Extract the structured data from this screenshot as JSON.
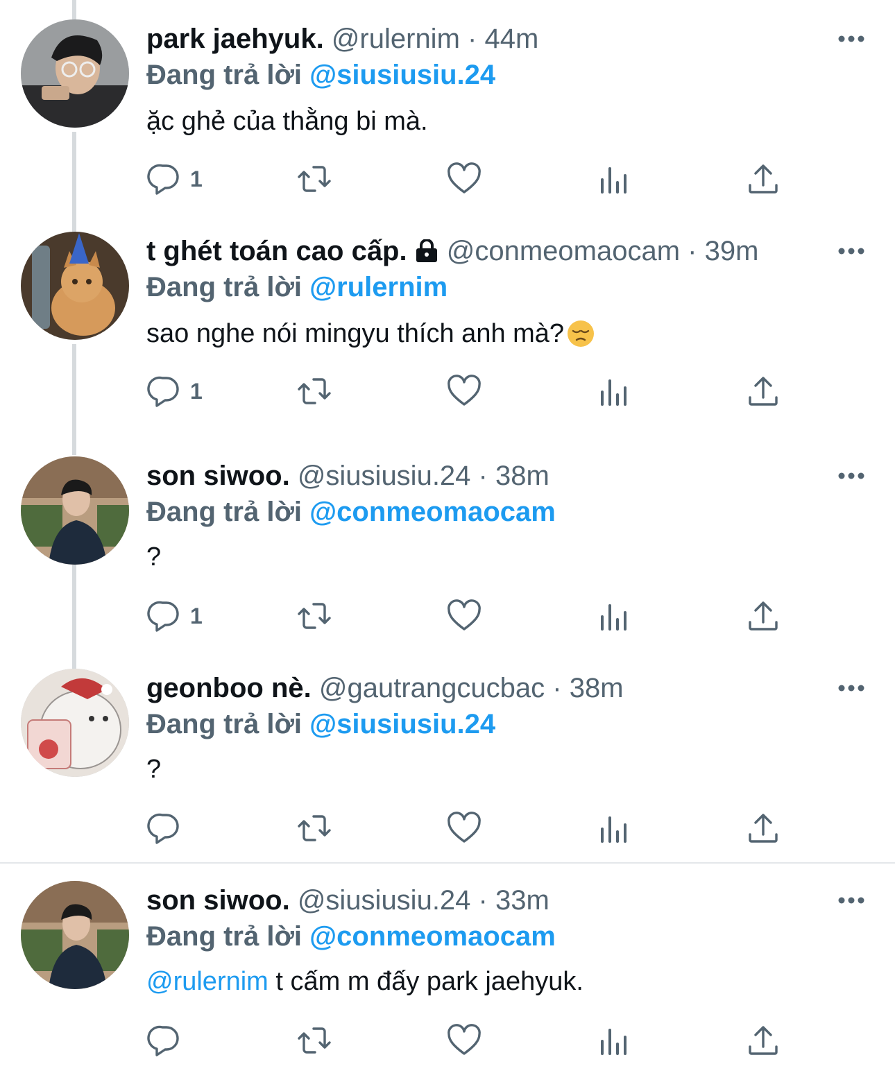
{
  "colors": {
    "accent": "#1d9bf0",
    "muted": "#536471",
    "text": "#0f1419"
  },
  "icons": {
    "reply": "reply-bubble-icon",
    "retweet": "retweet-icon",
    "like": "heart-icon",
    "views": "views-bar-icon",
    "share": "share-icon",
    "more": "more-dots-icon",
    "lock": "lock-icon"
  },
  "tweets": [
    {
      "name": "park jaehyuk.",
      "handle": "@rulernim",
      "sep": "·",
      "time": "44m",
      "reply_prefix": "Đang trả lời",
      "reply_to": "@siusiusiu.24",
      "mention": "",
      "text": "ặc ghẻ của thằng bi mà.",
      "reply_count": "1"
    },
    {
      "name": "t ghét toán cao cấp.",
      "handle": "@conmeomaocam",
      "sep": "·",
      "time": "39m",
      "reply_prefix": "Đang trả lời",
      "reply_to": "@rulernim",
      "mention": "",
      "text": "sao nghe nói mingyu thích anh mà?",
      "emoji": "pensive-face",
      "reply_count": "1",
      "locked": true
    },
    {
      "name": "son siwoo.",
      "handle": "@siusiusiu.24",
      "sep": "·",
      "time": "38m",
      "reply_prefix": "Đang trả lời",
      "reply_to": "@conmeomaocam",
      "mention": "",
      "text": "?",
      "reply_count": "1"
    },
    {
      "name": "geonboo nè.",
      "handle": "@gautrangcucbac",
      "sep": "·",
      "time": "38m",
      "reply_prefix": "Đang trả lời",
      "reply_to": "@siusiusiu.24",
      "mention": "",
      "text": "?",
      "reply_count": ""
    },
    {
      "name": "son siwoo.",
      "handle": "@siusiusiu.24",
      "sep": "·",
      "time": "33m",
      "reply_prefix": "Đang trả lời",
      "reply_to": "@conmeomaocam",
      "mention": "@rulernim",
      "text": " t cấm m đấy park jaehyuk.",
      "reply_count": ""
    }
  ]
}
